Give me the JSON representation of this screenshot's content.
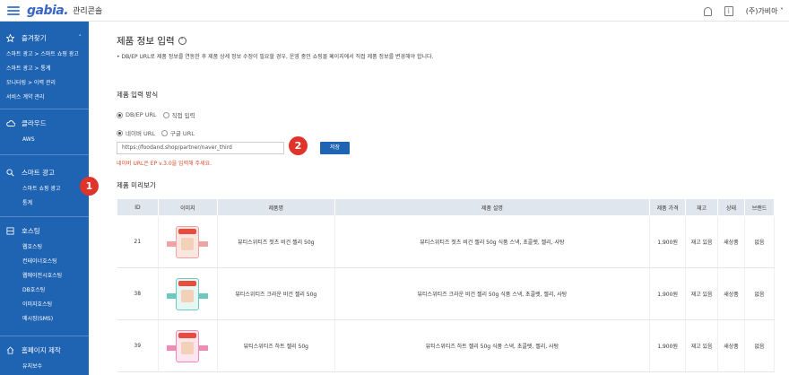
{
  "topbar": {
    "logo": "gabia.",
    "subtitle": "관리콘솔",
    "user": "(주)가비아"
  },
  "sidebar": {
    "favorites": {
      "label": "즐겨찾기",
      "items": [
        "스마트 광고 > 스마트 쇼핑 광고",
        "스마트 광고 > 통계",
        "모니터링 > 이력 관리",
        "서비스 계약 관리"
      ]
    },
    "cloud": {
      "label": "클라우드",
      "items": [
        "AWS"
      ]
    },
    "smart_ad": {
      "label": "스마트 광고",
      "items": [
        "스마트 쇼핑 광고",
        "통계"
      ]
    },
    "hosting": {
      "label": "호스팅",
      "items": [
        "웹호스팅",
        "컨테이너호스팅",
        "웹에이전시호스팅",
        "DB호스팅",
        "이미지호스팅",
        "메시징(SMS)"
      ]
    },
    "homepage": {
      "label": "홈페이지 제작",
      "items": [
        "유지보수"
      ]
    }
  },
  "main": {
    "title": "제품 정보 입력",
    "notice": "•  DB/EP URL로 제품 정보를 연동한 후 제품 상세 정보 수정이 필요할 경우, 운영 중인 쇼핑몰 페이지에서 직접 제품 정보를 변경해야 합니다.",
    "input_method_label": "제품 입력 방식",
    "method_options": [
      "DB/EP URL",
      "직접 입력"
    ],
    "url_type_options": [
      "네이버 URL",
      "구글 URL"
    ],
    "url_value": "https://foodand.shop/partner/naver_third",
    "save_label": "저장",
    "hint": "네이버 URL은 EP v.3.0을 입력해 주세요.",
    "preview_label": "제품 미리보기"
  },
  "badges": [
    "1",
    "2"
  ],
  "table": {
    "headers": [
      "ID",
      "이미지",
      "제품명",
      "제품 설명",
      "제품 가격",
      "재고",
      "상태",
      "브랜드"
    ],
    "rows": [
      {
        "id": "21",
        "name": "뷰티스위티즈 젓츠 비건 젤리 50g",
        "desc": "뷰티스위티즈 젓츠 비건 젤리 50g 식품 스낵, 초콜렛, 젤리, 사탕",
        "price": "1,900원",
        "stock": "재고 있음",
        "status": "새상품",
        "brand": "없음",
        "band_color": "#f0a3a3",
        "pack_color": "#fbe7e1"
      },
      {
        "id": "38",
        "name": "뷰티스위티즈 크라운 비건 젤리 50g",
        "desc": "뷰티스위티즈 크라운 비건 젤리 50g 식품 스낵, 초콜렛, 젤리, 사탕",
        "price": "1,900원",
        "stock": "재고 있음",
        "status": "새상품",
        "brand": "없음",
        "band_color": "#6cc9c0",
        "pack_color": "#e7f5f3"
      },
      {
        "id": "39",
        "name": "뷰티스위티즈 하트 젤리 50g",
        "desc": "뷰티스위티즈 하트 젤리 50g 식품 스낵, 초콜렛, 젤리, 사탕",
        "price": "1,900원",
        "stock": "재고 있음",
        "status": "새상품",
        "brand": "없음",
        "band_color": "#f28ab3",
        "pack_color": "#fde6ef"
      }
    ]
  },
  "colors": {
    "sidebar": "#1f63b3",
    "accent": "#1f63b3",
    "badge": "#e0342b",
    "hint": "#d94b2b"
  }
}
